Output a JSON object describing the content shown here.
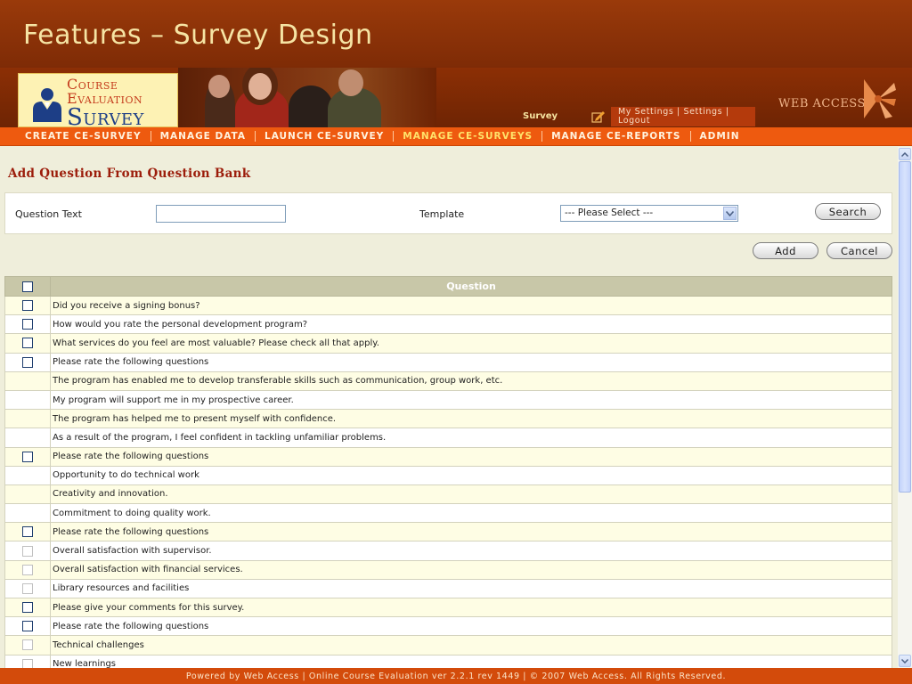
{
  "header": {
    "title": "Features – Survey Design"
  },
  "logo": {
    "line1": "Course",
    "line2": "Evaluation",
    "line3": "Survey"
  },
  "banner": {
    "survey_label": "Survey",
    "my_settings": "My Settings",
    "settings": "Settings",
    "logout": "Logout",
    "brand": "WEB ACCESS"
  },
  "nav": {
    "items": [
      {
        "label": "CREATE CE-SURVEY"
      },
      {
        "label": "MANAGE DATA"
      },
      {
        "label": "LAUNCH CE-SURVEY"
      },
      {
        "label": "MANAGE CE-SURVEYS"
      },
      {
        "label": "MANAGE CE-REPORTS"
      },
      {
        "label": "ADMIN"
      }
    ],
    "active_index": 3
  },
  "page": {
    "title": "Add Question From Question Bank",
    "question_text_label": "Question Text",
    "question_text_value": "",
    "template_label": "Template",
    "template_selected": "--- Please Select ---",
    "search_label": "Search",
    "add_label": "Add",
    "cancel_label": "Cancel"
  },
  "table": {
    "header": "Question",
    "rows": [
      {
        "text": "Did you receive a signing bonus?",
        "checkbox": "active"
      },
      {
        "text": "How would you rate the personal development program?",
        "checkbox": "active"
      },
      {
        "text": "What services do you feel are most valuable? Please check all that apply.",
        "checkbox": "active"
      },
      {
        "text": "Please rate the following questions",
        "checkbox": "active"
      },
      {
        "text": "The program has enabled me to develop transferable skills such as communication, group work, etc.",
        "checkbox": "none"
      },
      {
        "text": "My program will support me in my prospective career.",
        "checkbox": "none"
      },
      {
        "text": "The program has helped me to present myself with confidence.",
        "checkbox": "none"
      },
      {
        "text": "As a result of the program, I feel confident in tackling unfamiliar problems.",
        "checkbox": "none"
      },
      {
        "text": "Please rate the following questions",
        "checkbox": "active"
      },
      {
        "text": "Opportunity to do technical work",
        "checkbox": "none"
      },
      {
        "text": "Creativity and innovation.",
        "checkbox": "none"
      },
      {
        "text": "Commitment to doing quality work.",
        "checkbox": "none"
      },
      {
        "text": "Please rate the following questions",
        "checkbox": "active"
      },
      {
        "text": "Overall satisfaction with supervisor.",
        "checkbox": "disabled"
      },
      {
        "text": "Overall satisfaction with financial services.",
        "checkbox": "disabled"
      },
      {
        "text": "Library resources and facilities",
        "checkbox": "disabled"
      },
      {
        "text": "Please give your comments for this survey.",
        "checkbox": "active"
      },
      {
        "text": "Please rate the following questions",
        "checkbox": "active"
      },
      {
        "text": "Technical challenges",
        "checkbox": "disabled"
      },
      {
        "text": "New learnings",
        "checkbox": "disabled"
      }
    ]
  },
  "footer": {
    "text": "Powered by Web Access | Online Course Evaluation ver 2.2.1 rev 1449 | © 2007 Web Access. All Rights Reserved."
  },
  "colors": {
    "title_bg": "#8a3008",
    "nav_bg": "#ee5a0f",
    "nav_active": "#ffe36a",
    "page_title": "#9c1d0b",
    "row_odd": "#fefde4",
    "footer_bg": "#d34b0b"
  }
}
